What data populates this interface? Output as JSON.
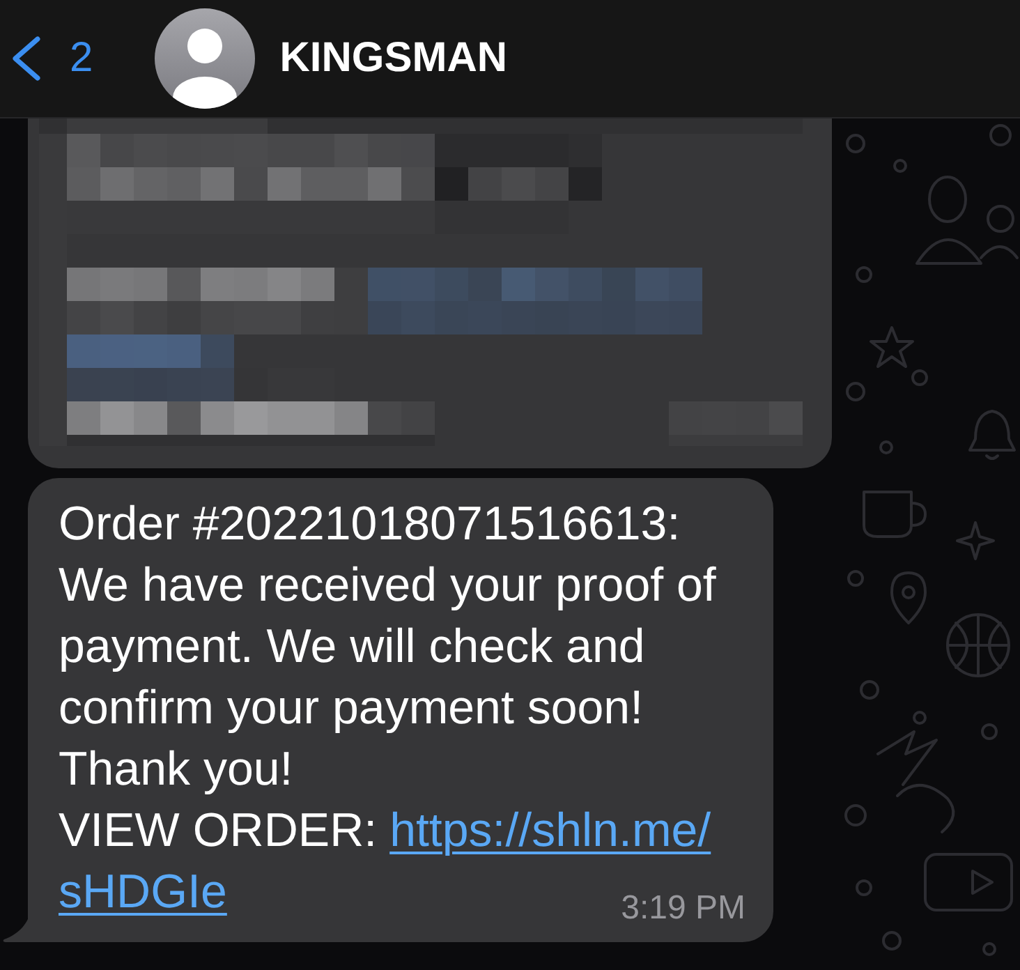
{
  "header": {
    "back_count": "2",
    "contact_name": "KINGSMAN"
  },
  "messages": [
    {
      "kind": "redacted"
    },
    {
      "kind": "text",
      "body": "Order #20221018071516613:\nWe have received your proof of payment. We will check and confirm your payment soon!\nThank you!",
      "link_label": "VIEW ORDER:",
      "link": "https://shln.me/sHDGIe",
      "time": "3:19 PM"
    }
  ]
}
